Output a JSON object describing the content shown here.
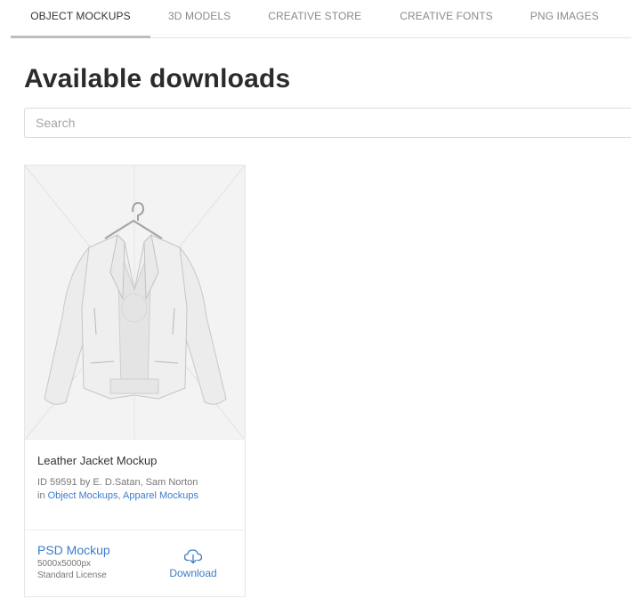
{
  "tabs": [
    {
      "label": "OBJECT MOCKUPS",
      "active": true
    },
    {
      "label": "3D MODELS"
    },
    {
      "label": "CREATIVE STORE"
    },
    {
      "label": "CREATIVE FONTS"
    },
    {
      "label": "PNG IMAGES"
    }
  ],
  "page": {
    "title": "Available downloads",
    "search_placeholder": "Search"
  },
  "items": [
    {
      "title": "Leather Jacket Mockup",
      "id_line": "ID 59591 by E. D.Satan, Sam Norton",
      "in_label": "in",
      "categories": [
        "Object Mockups",
        "Apparel Mockups"
      ],
      "separator": ",",
      "format": "PSD Mockup",
      "dimensions": "5000x5000px",
      "license": "Standard License",
      "download_label": "Download",
      "icon": "cloud-download-icon"
    }
  ],
  "colors": {
    "link": "#3d7cc9",
    "active_tab_underline": "#bdbdbd",
    "thumbnail_bg": "#f3f3f3"
  }
}
